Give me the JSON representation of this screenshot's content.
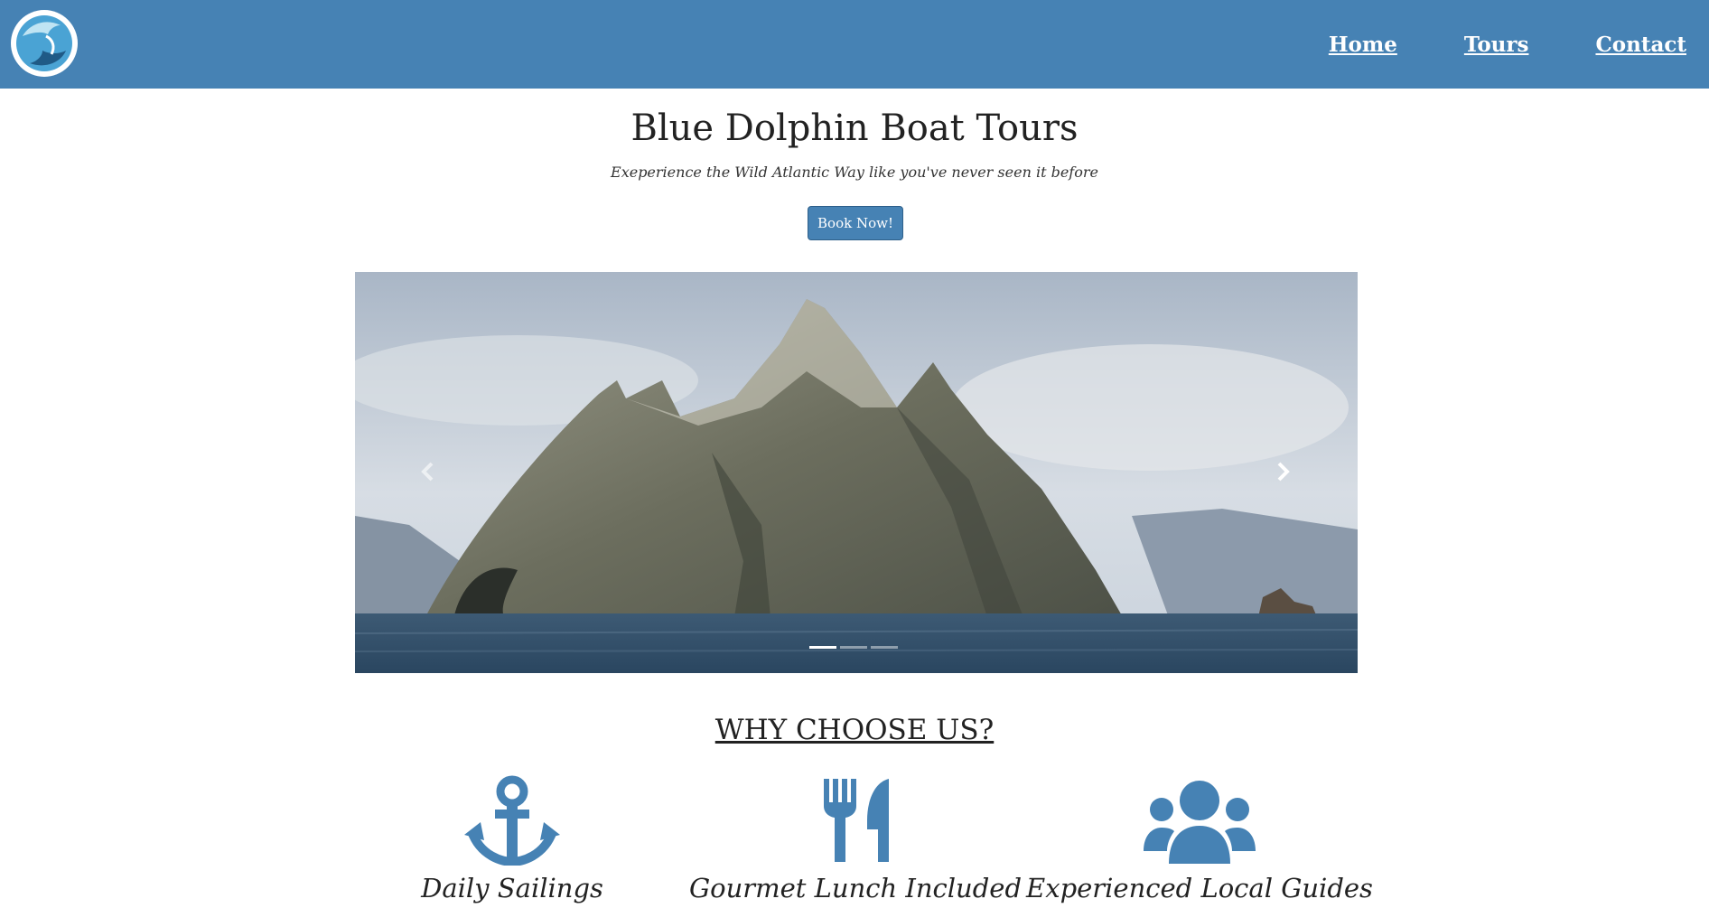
{
  "nav": {
    "links": [
      "Home",
      "Tours",
      "Contact"
    ]
  },
  "hero": {
    "title": "Blue Dolphin Boat Tours",
    "subtitle": "Exeperience the Wild Atlantic Way like you've never seen it before",
    "book_label": "Book Now!"
  },
  "carousel": {
    "slide_count": 3,
    "active_index": 0
  },
  "why": {
    "title": "WHY CHOOSE US?",
    "features": [
      {
        "label": "Daily Sailings",
        "icon": "anchor-icon"
      },
      {
        "label": "Gourmet Lunch Included",
        "icon": "utensils-icon"
      },
      {
        "label": "Experienced Local Guides",
        "icon": "users-icon"
      }
    ]
  },
  "colors": {
    "brand": "#4682b4"
  }
}
